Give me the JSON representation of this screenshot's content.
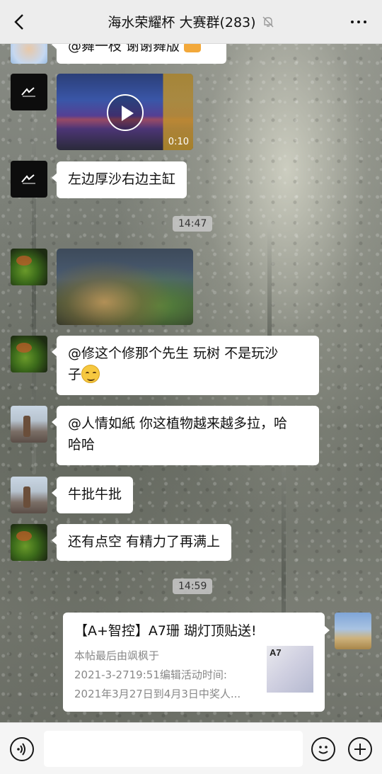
{
  "header": {
    "title": "海水荣耀杯 大赛群(283)"
  },
  "messages": {
    "m0": {
      "text": "@舞一枝  谢谢舞版"
    },
    "m1": {
      "duration": "0:10"
    },
    "m2": {
      "text": "左边厚沙右边主缸"
    },
    "t1": "14:47",
    "m4": {
      "line1": "@修这个修那个先生  玩树 不是玩沙",
      "line2": "子"
    },
    "m5": {
      "line1": "@人情如紙  你这植物越来越多拉，哈",
      "line2": "哈哈"
    },
    "m6": {
      "text": "牛批牛批"
    },
    "m7": {
      "text": "还有点空  有精力了再满上"
    },
    "t2": "14:59",
    "card": {
      "title": "【A+智控】A7珊 瑚灯顶贴送!",
      "desc1": "本帖最后由飒枫于",
      "desc2": "2021-3-2719:51编辑活动时间:",
      "desc3": "2021年3月27日到4月3日中奖人...",
      "thumb_text": "A7"
    }
  },
  "icons": {
    "back": "chevron-left-icon",
    "mute": "muted-bell-icon",
    "more": "more-dots-icon",
    "voice": "voice-icon",
    "emoji": "emoji-icon",
    "plus": "plus-icon"
  }
}
